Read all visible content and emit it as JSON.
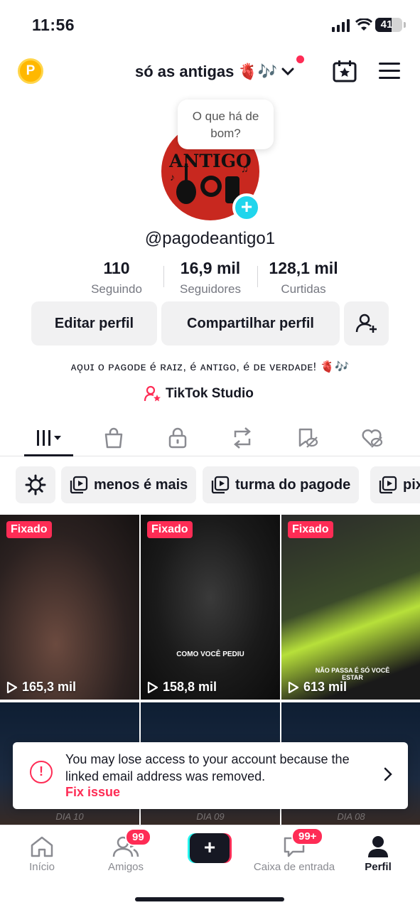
{
  "status_bar": {
    "time": "11:56",
    "battery": "41"
  },
  "header": {
    "coin_label": "P",
    "account_name": "só as antigas",
    "account_emoji": "🫀🎶"
  },
  "profile": {
    "avatar_text": "ANTIGO",
    "bubble_text": "O que há de bom?",
    "handle": "@pagodeantigo1",
    "stats": [
      {
        "value": "110",
        "label": "Seguindo"
      },
      {
        "value": "16,9 mil",
        "label": "Seguidores"
      },
      {
        "value": "128,1 mil",
        "label": "Curtidas"
      }
    ],
    "edit_button": "Editar perfil",
    "share_button": "Compartilhar perfil",
    "bio": "ᴀǫᴜɪ ᴏ ᴘᴀɢᴏᴅᴇ é ʀᴀɪᴢ, é ᴀɴᴛɪɢᴏ, é ᴅᴇ ᴠᴇʀᴅᴀᴅᴇ! 🫀🎶",
    "studio_label": "TikTok Studio"
  },
  "playlists": [
    "menos é mais",
    "turma do pagode",
    "pix"
  ],
  "videos": [
    {
      "pinned": "Fixado",
      "views": "165,3 mil",
      "caption": ""
    },
    {
      "pinned": "Fixado",
      "views": "158,8 mil",
      "caption": "COMO VOCÊ PEDIU"
    },
    {
      "pinned": "Fixado",
      "views": "613 mil",
      "caption": "NÃO PASSA É SÓ VOCÊ ESTAR"
    }
  ],
  "second_row": [
    {
      "day": "DIA 10"
    },
    {
      "day": "DIA 09"
    },
    {
      "day": "DIA 08"
    }
  ],
  "toast": {
    "message": "You may lose access to your account because the linked email address was removed.",
    "action": "Fix issue"
  },
  "tabbar": {
    "home": "Início",
    "friends": "Amigos",
    "friends_badge": "99",
    "inbox": "Caixa de entrada",
    "inbox_badge": "99+",
    "profile": "Perfil"
  },
  "colors": {
    "accent": "#fe2c55",
    "cyan": "#25f4ee",
    "text": "#161823"
  }
}
